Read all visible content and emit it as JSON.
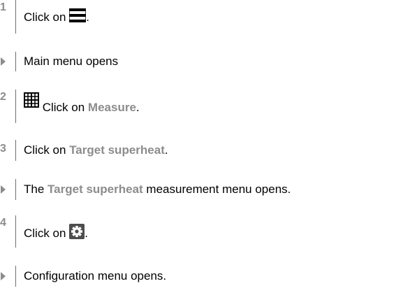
{
  "steps": [
    {
      "number": "1",
      "pre": "Click on ",
      "icon": "menu-icon",
      "post": "."
    },
    {
      "result": "Main menu opens"
    },
    {
      "number": "2",
      "icon": "grid-icon",
      "pre": " Click on ",
      "highlight": "Measure",
      "post": "."
    },
    {
      "number": "3",
      "pre": "Click on ",
      "highlight": "Target superheat",
      "post": "."
    },
    {
      "pre": "The ",
      "highlight": "Target superheat",
      "post": " measurement menu opens."
    },
    {
      "number": "4",
      "pre": "Click on ",
      "icon": "gear-icon",
      "post": "."
    },
    {
      "result": "Configuration menu opens."
    }
  ],
  "colors": {
    "step_number": "#8c8c8c",
    "highlight": "#8c8c8c",
    "rule": "#6e6e6e",
    "icon_bg": "#4d4d4d"
  }
}
